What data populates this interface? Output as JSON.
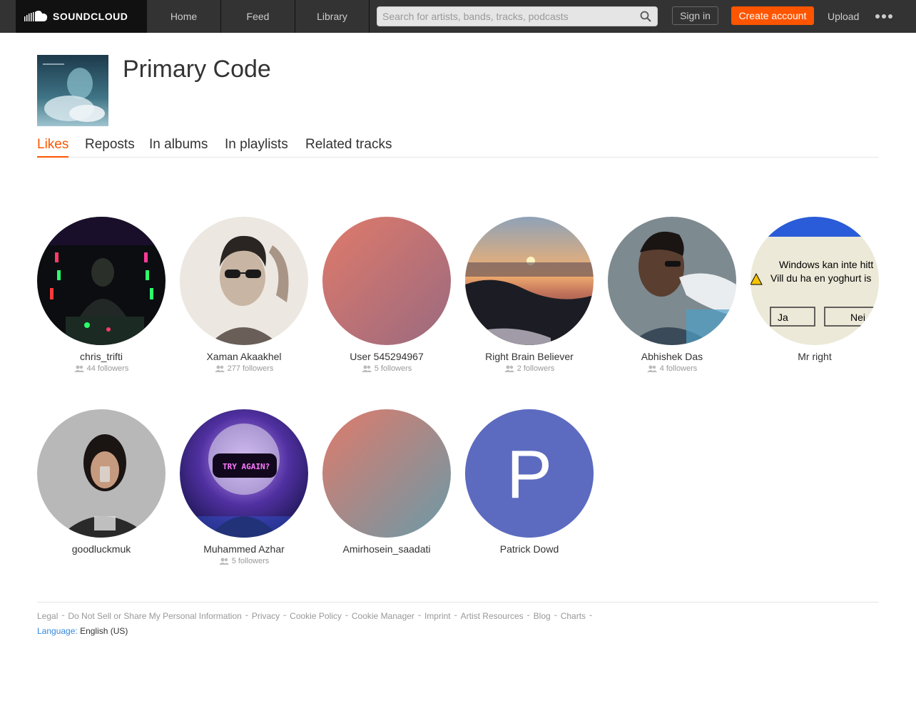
{
  "header": {
    "logo_text": "SOUNDCLOUD",
    "nav": [
      "Home",
      "Feed",
      "Library"
    ],
    "search_placeholder": "Search for artists, bands, tracks, podcasts",
    "signin_label": "Sign in",
    "create_label": "Create account",
    "upload_label": "Upload"
  },
  "track": {
    "title": "Primary Code"
  },
  "tabs": [
    "Likes",
    "Reposts",
    "In albums",
    "In playlists",
    "Related tracks"
  ],
  "users": [
    {
      "name": "chris_trifti",
      "followers": "44 followers"
    },
    {
      "name": "Xaman Akaakhel",
      "followers": "277 followers"
    },
    {
      "name": "User 545294967",
      "followers": "5 followers"
    },
    {
      "name": "Right Brain Believer",
      "followers": "2 followers"
    },
    {
      "name": "Abhishek Das",
      "followers": "4 followers"
    },
    {
      "name": "Mr right",
      "followers": ""
    },
    {
      "name": "goodluckmuk",
      "followers": ""
    },
    {
      "name": "Muhammed Azhar",
      "followers": "5 followers"
    },
    {
      "name": "Amirhosein_saadati",
      "followers": ""
    },
    {
      "name": "Patrick Dowd",
      "followers": "",
      "initial": "P"
    }
  ],
  "avatar_images": {
    "mr_right_lines": [
      "Windows kan inte hitt",
      "Vill du ha en yoghurt is"
    ],
    "mr_right_buttons": [
      "Ja",
      "Nei"
    ],
    "azhar_text": "TRY AGAIN?"
  },
  "footer": {
    "links": [
      "Legal",
      "Do Not Sell or Share My Personal Information",
      "Privacy",
      "Cookie Policy",
      "Cookie Manager",
      "Imprint",
      "Artist Resources",
      "Blog",
      "Charts"
    ],
    "language_label": "Language:",
    "language_value": "English (US)"
  },
  "colors": {
    "accent": "#ff5500",
    "header_bg": "#333333",
    "patrick_avatar": "#5c6bc0"
  }
}
